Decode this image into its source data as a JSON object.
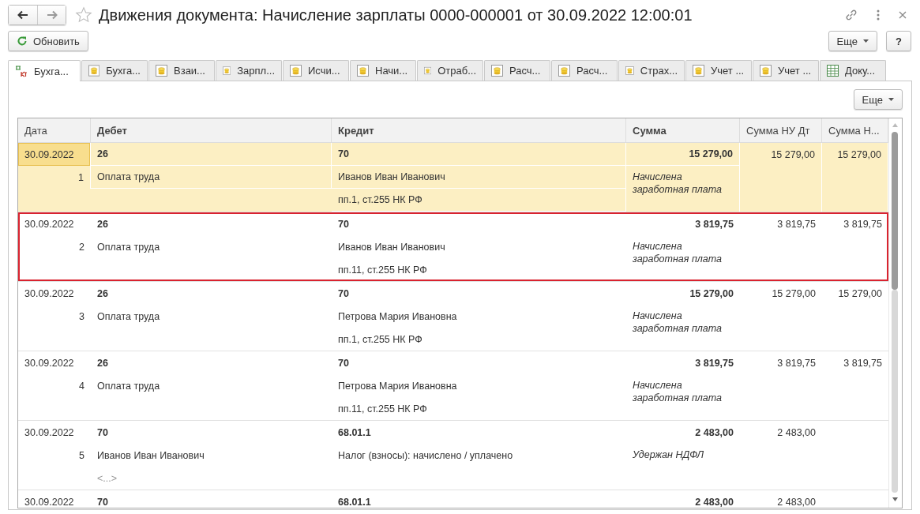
{
  "window": {
    "title": "Движения документа: Начисление зарплаты 0000-000001 от 30.09.2022 12:00:01"
  },
  "toolbar": {
    "refresh": "Обновить",
    "more": "Еще",
    "help": "?"
  },
  "tabs": [
    {
      "label": "Бухга...",
      "kind": "dtkt",
      "selected": true
    },
    {
      "label": "Бухга...",
      "kind": "register",
      "selected": false
    },
    {
      "label": "Взаи...",
      "kind": "register",
      "selected": false
    },
    {
      "label": "Зарпл...",
      "kind": "register",
      "selected": false
    },
    {
      "label": "Исчи...",
      "kind": "register",
      "selected": false
    },
    {
      "label": "Начи...",
      "kind": "register",
      "selected": false
    },
    {
      "label": "Отраб...",
      "kind": "register",
      "selected": false
    },
    {
      "label": "Расч...",
      "kind": "register",
      "selected": false
    },
    {
      "label": "Расч...",
      "kind": "register",
      "selected": false
    },
    {
      "label": "Страх...",
      "kind": "register",
      "selected": false
    },
    {
      "label": "Учет ...",
      "kind": "register",
      "selected": false
    },
    {
      "label": "Учет ...",
      "kind": "register",
      "selected": false
    },
    {
      "label": "Доку...",
      "kind": "table",
      "selected": false
    }
  ],
  "panel": {
    "more": "Еще"
  },
  "table": {
    "columns": [
      {
        "label": "Дата",
        "bold": false
      },
      {
        "label": "Дебет",
        "bold": true
      },
      {
        "label": "Кредит",
        "bold": true
      },
      {
        "label": "Сумма",
        "bold": true
      },
      {
        "label": "Сумма НУ Дт",
        "bold": false
      },
      {
        "label": "Сумма Н...",
        "bold": false
      }
    ],
    "rows": [
      {
        "date": "30.09.2022",
        "number": "1",
        "debit": [
          "26",
          "Оплата труда"
        ],
        "credit": [
          "70",
          "Иванов Иван Иванович",
          "пп.1, ст.255 НК РФ"
        ],
        "amount": "15 279,00",
        "description": "Начислена заработная плата",
        "amount_nu_dt": "15 279,00",
        "amount_n": "15 279,00",
        "selected": true,
        "highlighted": false
      },
      {
        "date": "30.09.2022",
        "number": "2",
        "debit": [
          "26",
          "Оплата труда"
        ],
        "credit": [
          "70",
          "Иванов Иван Иванович",
          "пп.11, ст.255 НК РФ"
        ],
        "amount": "3 819,75",
        "description": "Начислена заработная плата",
        "amount_nu_dt": "3 819,75",
        "amount_n": "3 819,75",
        "selected": false,
        "highlighted": true
      },
      {
        "date": "30.09.2022",
        "number": "3",
        "debit": [
          "26",
          "Оплата труда"
        ],
        "credit": [
          "70",
          "Петрова Мария Ивановна",
          "пп.1, ст.255 НК РФ"
        ],
        "amount": "15 279,00",
        "description": "Начислена заработная плата",
        "amount_nu_dt": "15 279,00",
        "amount_n": "15 279,00",
        "selected": false,
        "highlighted": false
      },
      {
        "date": "30.09.2022",
        "number": "4",
        "debit": [
          "26",
          "Оплата труда"
        ],
        "credit": [
          "70",
          "Петрова Мария Ивановна",
          "пп.11, ст.255 НК РФ"
        ],
        "amount": "3 819,75",
        "description": "Начислена заработная плата",
        "amount_nu_dt": "3 819,75",
        "amount_n": "3 819,75",
        "selected": false,
        "highlighted": false
      },
      {
        "date": "30.09.2022",
        "number": "5",
        "debit": [
          "70",
          "Иванов Иван Иванович"
        ],
        "debit_placeholder": "<...>",
        "credit": [
          "68.01.1",
          "Налог (взносы): начислено / уплачено"
        ],
        "amount": "2 483,00",
        "description": "Удержан НДФЛ",
        "amount_nu_dt": "2 483,00",
        "selected": false,
        "highlighted": false
      },
      {
        "date": "30.09.2022",
        "debit": [
          "70"
        ],
        "credit": [
          "68.01.1"
        ],
        "amount": "2 483,00",
        "amount_nu_dt": "2 483,00",
        "selected": false,
        "highlighted": false
      }
    ]
  }
}
